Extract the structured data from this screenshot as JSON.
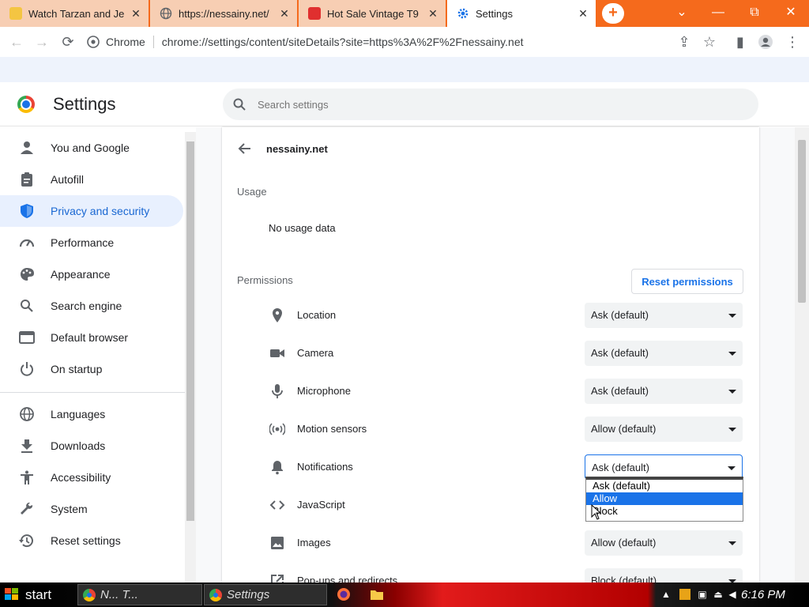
{
  "browser": {
    "tabs": [
      {
        "title": "Watch Tarzan and Je",
        "icon": "cartoon-favicon-icon",
        "active": false
      },
      {
        "title": "https://nessainy.net/",
        "icon": "globe-icon",
        "active": false
      },
      {
        "title": "Hot Sale Vintage T9",
        "icon": "shopping-bag-icon",
        "active": false
      },
      {
        "title": "Settings",
        "icon": "gear-icon",
        "active": true
      }
    ],
    "new_tab_label": "+",
    "window_controls": {
      "dropdown": "⌄",
      "minimize": "—",
      "restore": "⧉",
      "close": "✕"
    },
    "omnibox": {
      "scheme_label": "Chrome",
      "url": "chrome://settings/content/siteDetails?site=https%3A%2F%2Fnessainy.net"
    }
  },
  "settings": {
    "title": "Settings",
    "search_placeholder": "Search settings",
    "nav": [
      {
        "label": "You and Google",
        "icon": "person-icon",
        "selected": false
      },
      {
        "label": "Autofill",
        "icon": "clipboard-icon",
        "selected": false
      },
      {
        "label": "Privacy and security",
        "icon": "shield-icon",
        "selected": true
      },
      {
        "label": "Performance",
        "icon": "speedometer-icon",
        "selected": false
      },
      {
        "label": "Appearance",
        "icon": "palette-icon",
        "selected": false
      },
      {
        "label": "Search engine",
        "icon": "search-icon",
        "selected": false
      },
      {
        "label": "Default browser",
        "icon": "browser-window-icon",
        "selected": false
      },
      {
        "label": "On startup",
        "icon": "power-icon",
        "selected": false
      },
      {
        "label": "Languages",
        "icon": "globe-icon",
        "selected": false
      },
      {
        "label": "Downloads",
        "icon": "download-icon",
        "selected": false
      },
      {
        "label": "Accessibility",
        "icon": "accessibility-icon",
        "selected": false
      },
      {
        "label": "System",
        "icon": "wrench-icon",
        "selected": false
      },
      {
        "label": "Reset settings",
        "icon": "history-icon",
        "selected": false
      }
    ],
    "site": "nessainy.net",
    "usage_heading": "Usage",
    "usage_text": "No usage data",
    "permissions_heading": "Permissions",
    "reset_button": "Reset permissions",
    "permissions": [
      {
        "label": "Location",
        "icon": "location-pin-icon",
        "value": "Ask (default)"
      },
      {
        "label": "Camera",
        "icon": "camera-icon",
        "value": "Ask (default)"
      },
      {
        "label": "Microphone",
        "icon": "microphone-icon",
        "value": "Ask (default)"
      },
      {
        "label": "Motion sensors",
        "icon": "motion-sensor-icon",
        "value": "Allow (default)"
      },
      {
        "label": "Notifications",
        "icon": "bell-icon",
        "value": "Ask (default)",
        "open": true
      },
      {
        "label": "JavaScript",
        "icon": "code-icon",
        "value": ""
      },
      {
        "label": "Images",
        "icon": "image-icon",
        "value": "Allow (default)"
      },
      {
        "label": "Pop-ups and redirects",
        "icon": "popup-icon",
        "value": "Block (default)"
      }
    ],
    "dropdown_options": [
      "Ask (default)",
      "Allow",
      "Block"
    ],
    "dropdown_highlighted": 1
  },
  "taskbar": {
    "start_label": "start",
    "tasks": [
      {
        "label": "N... T...",
        "icon": "chrome-icon"
      },
      {
        "label": "Settings",
        "icon": "chrome-icon"
      }
    ],
    "quick_launch": [
      "firefox-icon",
      "folder-icon"
    ],
    "clock": "6:16 PM"
  },
  "colors": {
    "accent": "#1a73e8",
    "tabbar": "#f56a1c",
    "nav_selected_bg": "#e8f0fe"
  }
}
